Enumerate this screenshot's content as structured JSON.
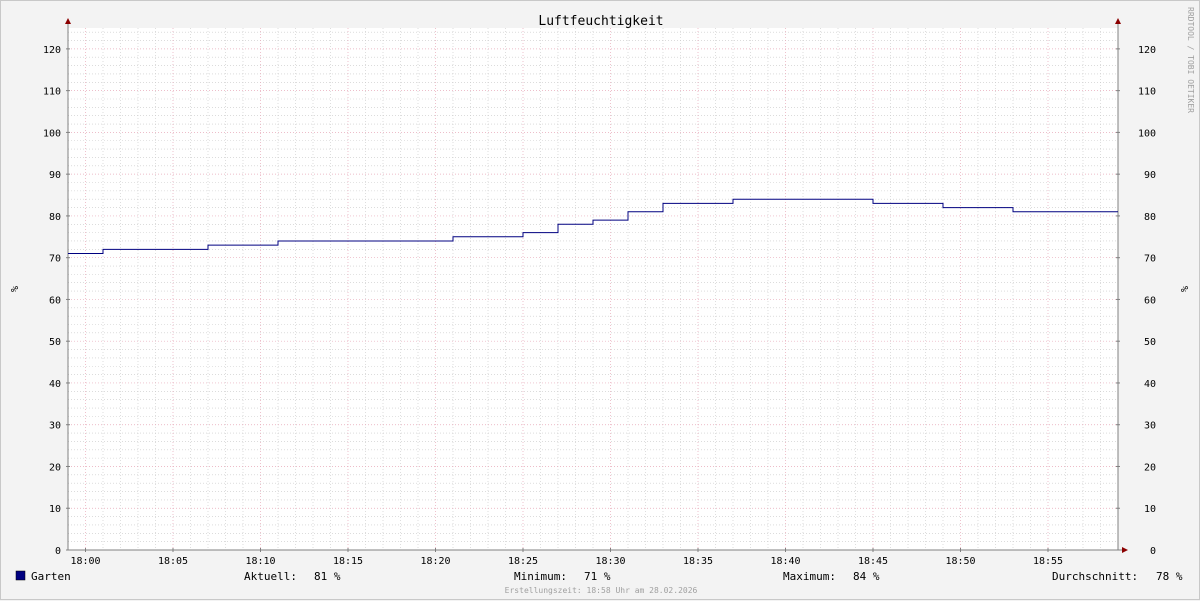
{
  "chart_data": {
    "type": "line",
    "title": "Luftfeuchtigkeit",
    "ylabel": "%",
    "ylim": [
      0,
      125
    ],
    "yticks": [
      0,
      10,
      20,
      30,
      40,
      50,
      60,
      70,
      80,
      90,
      100,
      110,
      120
    ],
    "xlim": [
      "17:59",
      "18:59"
    ],
    "xticks": [
      "18:00",
      "18:05",
      "18:10",
      "18:15",
      "18:20",
      "18:25",
      "18:30",
      "18:35",
      "18:40",
      "18:45",
      "18:50",
      "18:55"
    ],
    "grid": true,
    "legend": "bottom-left",
    "series": [
      {
        "name": "Garten",
        "color": "#000080",
        "step": true,
        "x": [
          "17:59",
          "18:01",
          "18:07",
          "18:11",
          "18:21",
          "18:25",
          "18:27",
          "18:29",
          "18:31",
          "18:33",
          "18:37",
          "18:45",
          "18:49",
          "18:53"
        ],
        "y": [
          71,
          72,
          73,
          74,
          75,
          76,
          78,
          79,
          81,
          83,
          84,
          83,
          82,
          81
        ],
        "end": "18:59"
      }
    ],
    "watermark": "RRDTOOL / TOBI OETIKER"
  },
  "legend": {
    "series_name": "Garten",
    "current_label": "Aktuell:",
    "current_value": "81 %",
    "min_label": "Minimum:",
    "min_value": "71 %",
    "max_label": "Maximum:",
    "max_value": "84 %",
    "avg_label": "Durchschnitt:",
    "avg_value": "78 %"
  },
  "footer": "Erstellungszeit: 18:58 Uhr am 28.02.2026",
  "colors": {
    "line": "#000080",
    "major_grid": "#e7a8b8",
    "minor_grid": "#c8c8c8",
    "axis": "#808080",
    "arrow": "#8b0000",
    "plot_bg": "#ffffff"
  }
}
